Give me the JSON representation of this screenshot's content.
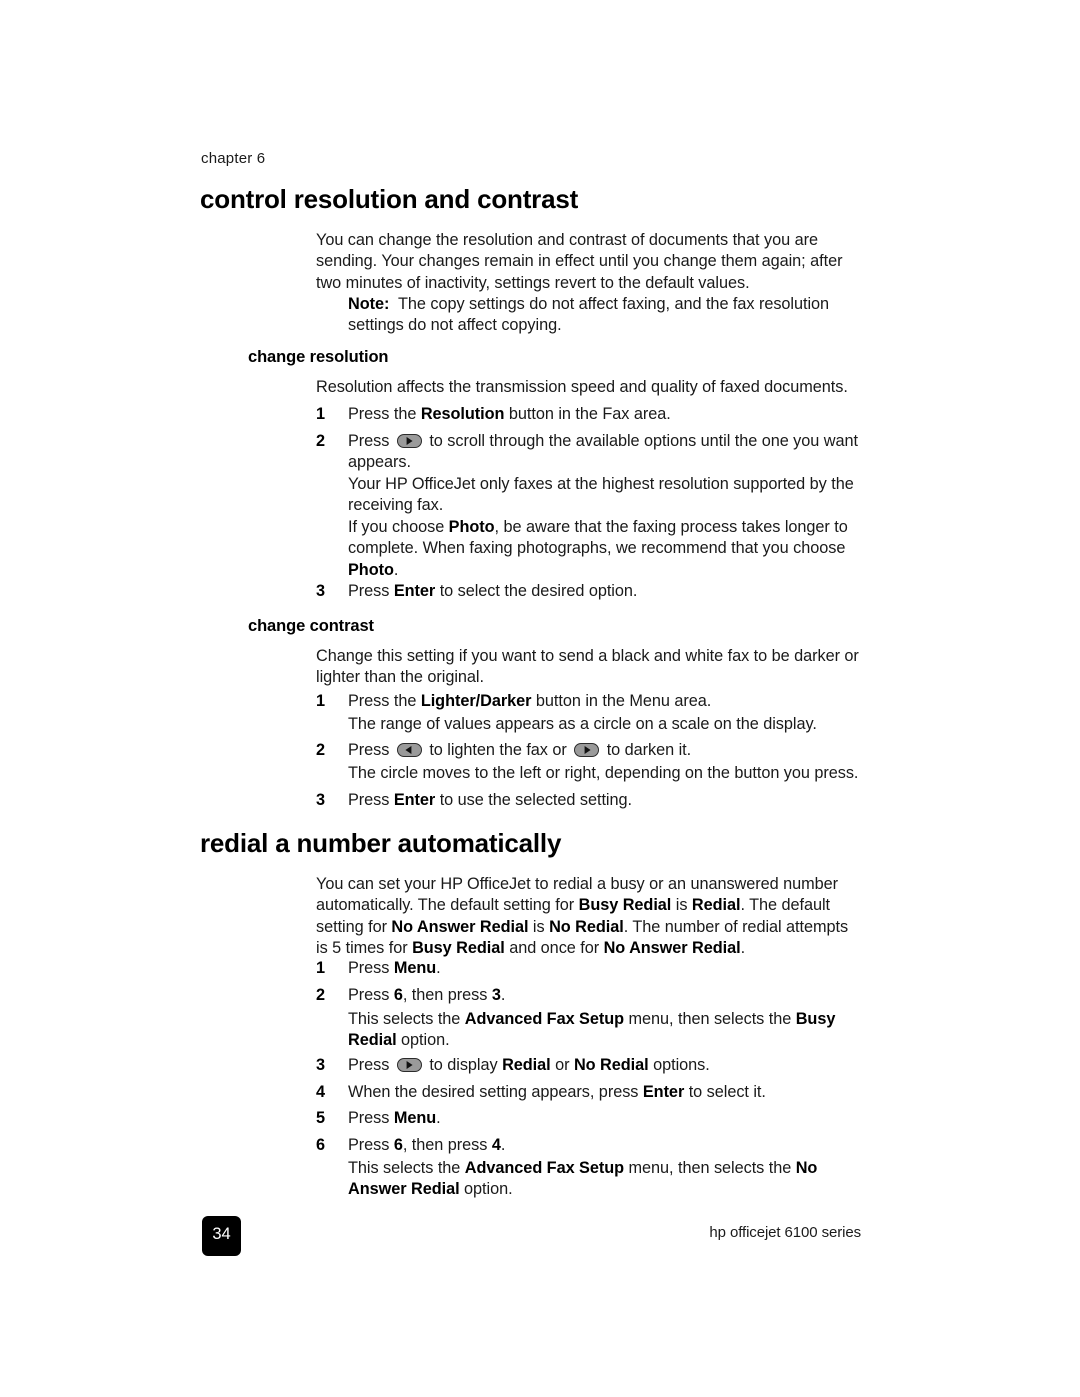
{
  "document": {
    "chapter_label": "chapter 6",
    "page_number": "34",
    "product_footer": "hp officejet 6100 series"
  },
  "sections": [
    {
      "id": "control-resolution-and-contrast",
      "heading": "control resolution and contrast",
      "intro": "You can change the resolution and contrast of documents that you are sending. Your changes remain in effect until you change them again; after two minutes of inactivity, settings revert to the default values.",
      "note_label": "Note:",
      "note_text": "The copy settings do not affect faxing, and the fax resolution settings do not affect copying."
    },
    {
      "id": "redial-a-number-automatically",
      "heading": "redial a number automatically"
    }
  ],
  "change_resolution": {
    "heading": "change resolution",
    "intro": "Resolution affects the transmission speed and quality of faxed documents.",
    "steps": [
      {
        "num": "1",
        "parts": [
          "Press the ",
          "Resolution",
          " button in the Fax area."
        ]
      },
      {
        "num": "2",
        "parts": [
          "Press ",
          "[right-arrow]",
          " to scroll through the available options until the one you want appears."
        ]
      },
      {
        "num": "3",
        "parts": [
          "Press ",
          "Enter",
          " to select the desired option."
        ]
      }
    ],
    "note_highest_resolution": "Your HP OfficeJet only faxes at the highest resolution supported by the receiving fax.",
    "note_photo_prefix": "If you choose ",
    "note_photo_bold1": "Photo",
    "note_photo_middle": ", be aware that the faxing process takes longer to complete. When faxing photographs, we recommend that you choose ",
    "note_photo_bold2": "Photo",
    "note_photo_suffix": "."
  },
  "change_contrast": {
    "heading": "change contrast",
    "intro": "Change this setting if you want to send a black and white fax to be darker or lighter than the original.",
    "step1_prefix": "Press the ",
    "step1_bold": "Lighter/Darker",
    "step1_suffix": " button in the Menu area.",
    "step1_note": "The range of values appears as a circle on a scale on the display.",
    "step2_prefix": "Press ",
    "step2_middle": " to lighten the fax or ",
    "step2_suffix": " to darken it.",
    "step2_note": "The circle moves to the left or right, depending on the button you press.",
    "step3_prefix": "Press ",
    "step3_bold": "Enter",
    "step3_suffix": " to use the selected setting.",
    "nums": {
      "one": "1",
      "two": "2",
      "three": "3"
    }
  },
  "redial": {
    "heading": "redial a number automatically",
    "intro_p1": "You can set your HP OfficeJet to redial a busy or an unanswered number automatically. The default setting for ",
    "intro_b1": "Busy Redial",
    "intro_p2": " is ",
    "intro_b2": "Redial",
    "intro_p3": ". The default setting for ",
    "intro_b3": "No Answer Redial",
    "intro_p4": " is ",
    "intro_b4": "No Redial",
    "intro_p5": ". The number of redial attempts is 5 times for ",
    "intro_b5": "Busy Redial",
    "intro_p6": " and once for ",
    "intro_b6": "No Answer Redial",
    "intro_p7": ".",
    "steps": {
      "s1_num": "1",
      "s1_prefix": "Press ",
      "s1_bold": "Menu",
      "s1_suffix": ".",
      "s2_num": "2",
      "s2_prefix": "Press ",
      "s2_bold1": "6",
      "s2_middle": ", then press ",
      "s2_bold2": "3",
      "s2_suffix": ".",
      "s2_note_p1": "This selects the ",
      "s2_note_b1": "Advanced Fax Setup",
      "s2_note_p2": " menu, then selects the ",
      "s2_note_b2": "Busy Redial",
      "s2_note_p3": " option.",
      "s3_num": "3",
      "s3_prefix": "Press ",
      "s3_middle": " to display ",
      "s3_bold1": "Redial",
      "s3_or": " or ",
      "s3_bold2": "No Redial",
      "s3_suffix": " options.",
      "s4_num": "4",
      "s4_prefix": "When the desired setting appears, press ",
      "s4_bold": "Enter",
      "s4_suffix": " to select it.",
      "s5_num": "5",
      "s5_prefix": "Press ",
      "s5_bold": "Menu",
      "s5_suffix": ".",
      "s6_num": "6",
      "s6_prefix": "Press ",
      "s6_bold1": "6",
      "s6_middle": ", then press ",
      "s6_bold2": "4",
      "s6_suffix": ".",
      "s6_note_p1": "This selects the ",
      "s6_note_b1": "Advanced Fax Setup",
      "s6_note_p2": " menu, then selects the ",
      "s6_note_b2": "No Answer Redial",
      "s6_note_p3": " option."
    }
  },
  "icons": {
    "right_arrow": "right-arrow-button-icon",
    "left_arrow": "left-arrow-button-icon"
  }
}
